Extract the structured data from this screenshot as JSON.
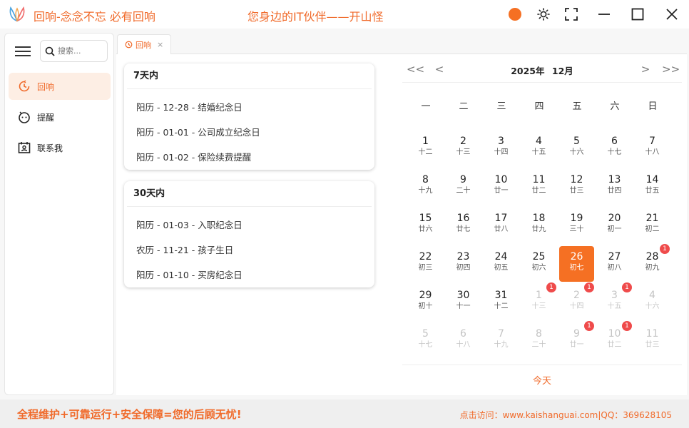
{
  "app": {
    "title": "回响-念念不忘 必有回响",
    "slogan": "您身边的IT伙伴——开山怪",
    "accent_color": "#f57023",
    "logo_icon": "tulip-logo-icon"
  },
  "window_controls": {
    "theme_dot_icon": "theme-color-dot-icon",
    "brightness_icon": "sun-icon",
    "fullscreen_icon": "fullscreen-icon",
    "minimize_icon": "minimize-icon",
    "maximize_icon": "maximize-icon",
    "close_icon": "close-icon"
  },
  "sidebar": {
    "search_placeholder": "搜索...",
    "items": [
      {
        "label": "回响",
        "icon": "clock-icon",
        "active": true
      },
      {
        "label": "提醒",
        "icon": "bell-face-icon",
        "active": false
      },
      {
        "label": "联系我",
        "icon": "contact-card-icon",
        "active": false
      }
    ]
  },
  "tabs": [
    {
      "label": "回响",
      "icon": "clock-icon",
      "close": "×"
    }
  ],
  "reminders": {
    "week": {
      "title": "7天内",
      "items": [
        "阳历 - 12-28 - 结婚纪念日",
        "阳历 - 01-01 - 公司成立纪念日",
        "阳历 - 01-02 - 保险续费提醒"
      ]
    },
    "month": {
      "title": "30天内",
      "items": [
        "阳历 - 01-03 - 入职纪念日",
        "农历 - 11-21 - 孩子生日",
        "阳历 - 01-10 - 买房纪念日"
      ]
    }
  },
  "calendar": {
    "year_label": "2025年",
    "month_label": "12月",
    "prev_year": "<<",
    "prev_month": "<",
    "next_month": ">",
    "next_year": ">>",
    "weekdays": [
      "一",
      "二",
      "三",
      "四",
      "五",
      "六",
      "日"
    ],
    "today_label": "今天",
    "days": [
      {
        "n": "1",
        "l": "十二"
      },
      {
        "n": "2",
        "l": "十三"
      },
      {
        "n": "3",
        "l": "十四"
      },
      {
        "n": "4",
        "l": "十五"
      },
      {
        "n": "5",
        "l": "十六"
      },
      {
        "n": "6",
        "l": "十七"
      },
      {
        "n": "7",
        "l": "十八"
      },
      {
        "n": "8",
        "l": "十九"
      },
      {
        "n": "9",
        "l": "二十"
      },
      {
        "n": "10",
        "l": "廿一"
      },
      {
        "n": "11",
        "l": "廿二"
      },
      {
        "n": "12",
        "l": "廿三"
      },
      {
        "n": "13",
        "l": "廿四"
      },
      {
        "n": "14",
        "l": "廿五"
      },
      {
        "n": "15",
        "l": "廿六"
      },
      {
        "n": "16",
        "l": "廿七"
      },
      {
        "n": "17",
        "l": "廿八"
      },
      {
        "n": "18",
        "l": "廿九"
      },
      {
        "n": "19",
        "l": "三十"
      },
      {
        "n": "20",
        "l": "初一"
      },
      {
        "n": "21",
        "l": "初二"
      },
      {
        "n": "22",
        "l": "初三"
      },
      {
        "n": "23",
        "l": "初四"
      },
      {
        "n": "24",
        "l": "初五"
      },
      {
        "n": "25",
        "l": "初六"
      },
      {
        "n": "26",
        "l": "初七",
        "today": true
      },
      {
        "n": "27",
        "l": "初八"
      },
      {
        "n": "28",
        "l": "初九",
        "badge": "1"
      },
      {
        "n": "29",
        "l": "初十"
      },
      {
        "n": "30",
        "l": "十一"
      },
      {
        "n": "31",
        "l": "十二"
      },
      {
        "n": "1",
        "l": "十三",
        "other": true,
        "badge": "1"
      },
      {
        "n": "2",
        "l": "十四",
        "other": true,
        "badge": "1"
      },
      {
        "n": "3",
        "l": "十五",
        "other": true,
        "badge": "1"
      },
      {
        "n": "4",
        "l": "十六",
        "other": true
      },
      {
        "n": "5",
        "l": "十七",
        "other": true
      },
      {
        "n": "6",
        "l": "十八",
        "other": true
      },
      {
        "n": "7",
        "l": "十九",
        "other": true
      },
      {
        "n": "8",
        "l": "二十",
        "other": true
      },
      {
        "n": "9",
        "l": "廿一",
        "other": true,
        "badge": "1"
      },
      {
        "n": "10",
        "l": "廿二",
        "other": true,
        "badge": "1"
      },
      {
        "n": "11",
        "l": "廿三",
        "other": true
      }
    ]
  },
  "footer": {
    "left": "全程维护+可靠运行+安全保障=您的后顾无忧!",
    "right": "点击访问：www.kaishanguai.com|QQ：369628105"
  }
}
